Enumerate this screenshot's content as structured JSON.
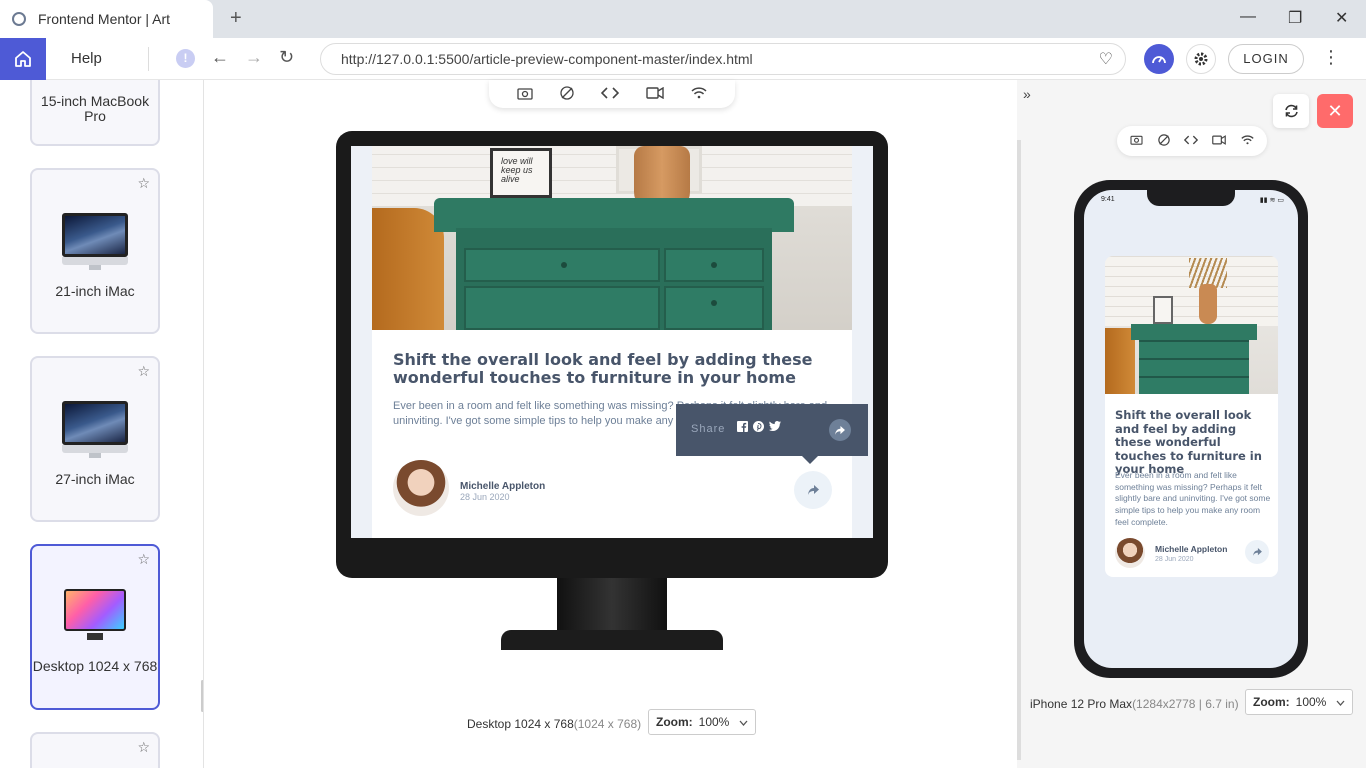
{
  "browser": {
    "tab_title": "Frontend Mentor | Art",
    "new_tab": "+",
    "minimize": "—",
    "restore": "❐",
    "close": "✕",
    "help_label": "Help",
    "info": "!",
    "back": "←",
    "forward": "→",
    "reload": "↻",
    "url": "http://127.0.0.1:5500/article-preview-component-master/index.html",
    "favorite": "♡",
    "login_label": "LOGIN",
    "menu": "⋮"
  },
  "sidebar": {
    "devices": [
      {
        "label": "15-inch MacBook Pro"
      },
      {
        "label": "21-inch iMac"
      },
      {
        "label": "27-inch iMac"
      },
      {
        "label": "Desktop 1024 x 768",
        "active": true
      }
    ],
    "star": "☆"
  },
  "main": {
    "device_tools": [
      "screenshot-icon",
      "rotate-off-icon",
      "code-icon",
      "video-icon",
      "wifi-icon"
    ],
    "device_name": "Desktop 1024 x 768",
    "device_dims": "(1024 x 768)",
    "zoom_label": "Zoom:",
    "zoom_value": "100%"
  },
  "article": {
    "title": "Shift the overall look and feel by adding these wonderful touches to furniture in your home",
    "body_desktop": "Ever been in a room and felt like something was missing? Perhaps it felt slightly bare and uninviting. I've got some simple tips to help you make any room feel complete.",
    "body_mobile": "Ever been in a room and felt like something was missing? Perhaps it felt slightly bare and uninviting. I've got some simple tips to help you make any room feel complete.",
    "author": "Michelle Appleton",
    "date": "28 Jun 2020",
    "share_label": "Share",
    "frame_text": "love will keep us alive"
  },
  "phone": {
    "time": "9:41",
    "device_name": "iPhone 12 Pro Max",
    "device_dims": "(1284x2778 | 6.7 in)",
    "zoom_label": "Zoom:",
    "zoom_value": "100%"
  },
  "colors": {
    "accent": "#4e5ad6",
    "close_red": "#ff6b6b",
    "article_title": "#48556a",
    "article_text": "#6e8098"
  }
}
